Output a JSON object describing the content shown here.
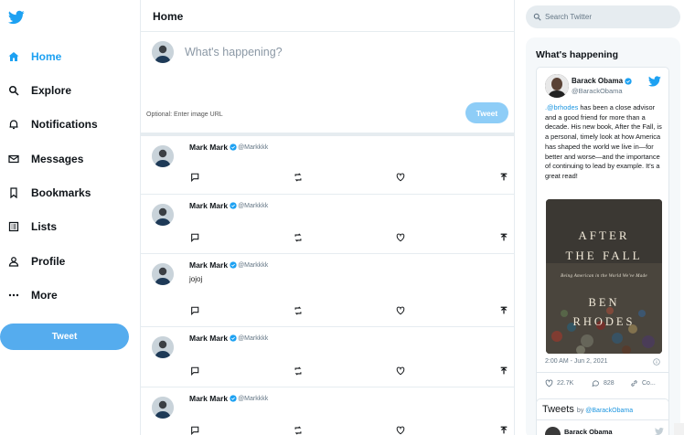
{
  "brand": {
    "accent": "#1da1f2",
    "tweet_button": "#55acee",
    "tweet_button_disabled": "#8ecdf7"
  },
  "sidebar": {
    "logo_icon": "twitter-bird-icon",
    "items": [
      {
        "label": "Home",
        "icon": "home-icon",
        "active": true
      },
      {
        "label": "Explore",
        "icon": "search-icon"
      },
      {
        "label": "Notifications",
        "icon": "bell-icon"
      },
      {
        "label": "Messages",
        "icon": "mail-icon"
      },
      {
        "label": "Bookmarks",
        "icon": "bookmark-icon"
      },
      {
        "label": "Lists",
        "icon": "list-icon"
      },
      {
        "label": "Profile",
        "icon": "person-icon"
      },
      {
        "label": "More",
        "icon": "more-icon"
      }
    ],
    "tweet_label": "Tweet"
  },
  "main": {
    "title": "Home",
    "composer": {
      "placeholder": "What's happening?",
      "image_url_placeholder": "Optional: Enter image URL",
      "tweet_label": "Tweet"
    },
    "tweets": [
      {
        "name": "Mark Mark",
        "handle": "@Markkkk",
        "text": ""
      },
      {
        "name": "Mark Mark",
        "handle": "@Markkkk",
        "text": ""
      },
      {
        "name": "Mark Mark",
        "handle": "@Markkkk",
        "text": "jojoj"
      },
      {
        "name": "Mark Mark",
        "handle": "@Markkkk",
        "text": ""
      },
      {
        "name": "Mark Mark",
        "handle": "@Markkkk",
        "text": ""
      }
    ]
  },
  "right": {
    "search_placeholder": "Search Twitter",
    "whats_happening": "What's happening",
    "embed": {
      "name": "Barack Obama",
      "handle": "@BarackObama",
      "mention": ".@brhodes",
      "text": " has been a close advisor and a good friend for more than a decade. His new book, After the Fall, is a personal, timely look at how America has shaped the world we live in—for better and worse—and the importance of continuing to lead by example. It's a great read!",
      "book": {
        "line1": "AFTER",
        "line2": "THE FALL",
        "subtitle": "Being American in the World We've Made",
        "author1": "BEN",
        "author2": "RHODES"
      },
      "timestamp": "2:00 AM - Jun 2, 2021",
      "likes": "22.7K",
      "replies": "828",
      "copy_label": "Co..."
    },
    "timeline": {
      "title": "Tweets",
      "by": "by",
      "by_handle": "@BarackObama",
      "first_name": "Barack Obama"
    }
  }
}
